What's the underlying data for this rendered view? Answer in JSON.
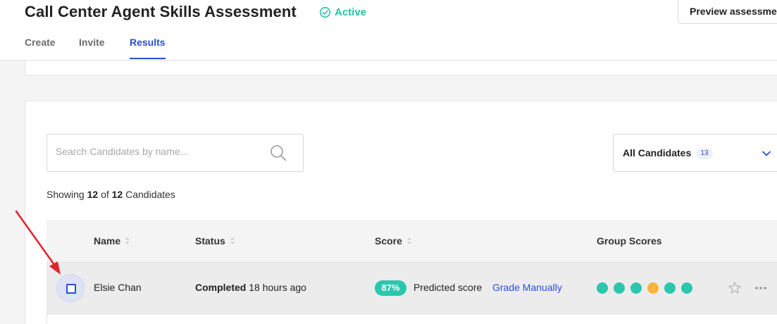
{
  "header": {
    "title": "Call Center Agent Skills Assessment",
    "status": "Active",
    "preview_button": "Preview assessment"
  },
  "tabs": [
    {
      "label": "Create",
      "active": false
    },
    {
      "label": "Invite",
      "active": false
    },
    {
      "label": "Results",
      "active": true
    }
  ],
  "search": {
    "placeholder": "Search Candidates by name..."
  },
  "filter": {
    "label": "All Candidates",
    "count": "13"
  },
  "showing": {
    "prefix": "Showing",
    "shown": "12",
    "of": "of",
    "total": "12",
    "suffix": "Candidates"
  },
  "table": {
    "columns": [
      "Name",
      "Status",
      "Score",
      "Group Scores"
    ],
    "rows": [
      {
        "name": "Elsie Chan",
        "status": "Completed",
        "time": "18 hours ago",
        "score": "87%",
        "score_label": "Predicted score",
        "grade_link": "Grade Manually",
        "group_scores": [
          "#2bc7ad",
          "#2bc7ad",
          "#2bc7ad",
          "#f5b73b",
          "#2bc7ad",
          "#2bc7ad"
        ]
      }
    ]
  },
  "colors": {
    "accent": "#2a4fd6",
    "active_green": "#2bbfa3",
    "score_teal": "#2bc7ad",
    "warning_yellow": "#f5b73b",
    "annotation_red": "#e0242b"
  }
}
